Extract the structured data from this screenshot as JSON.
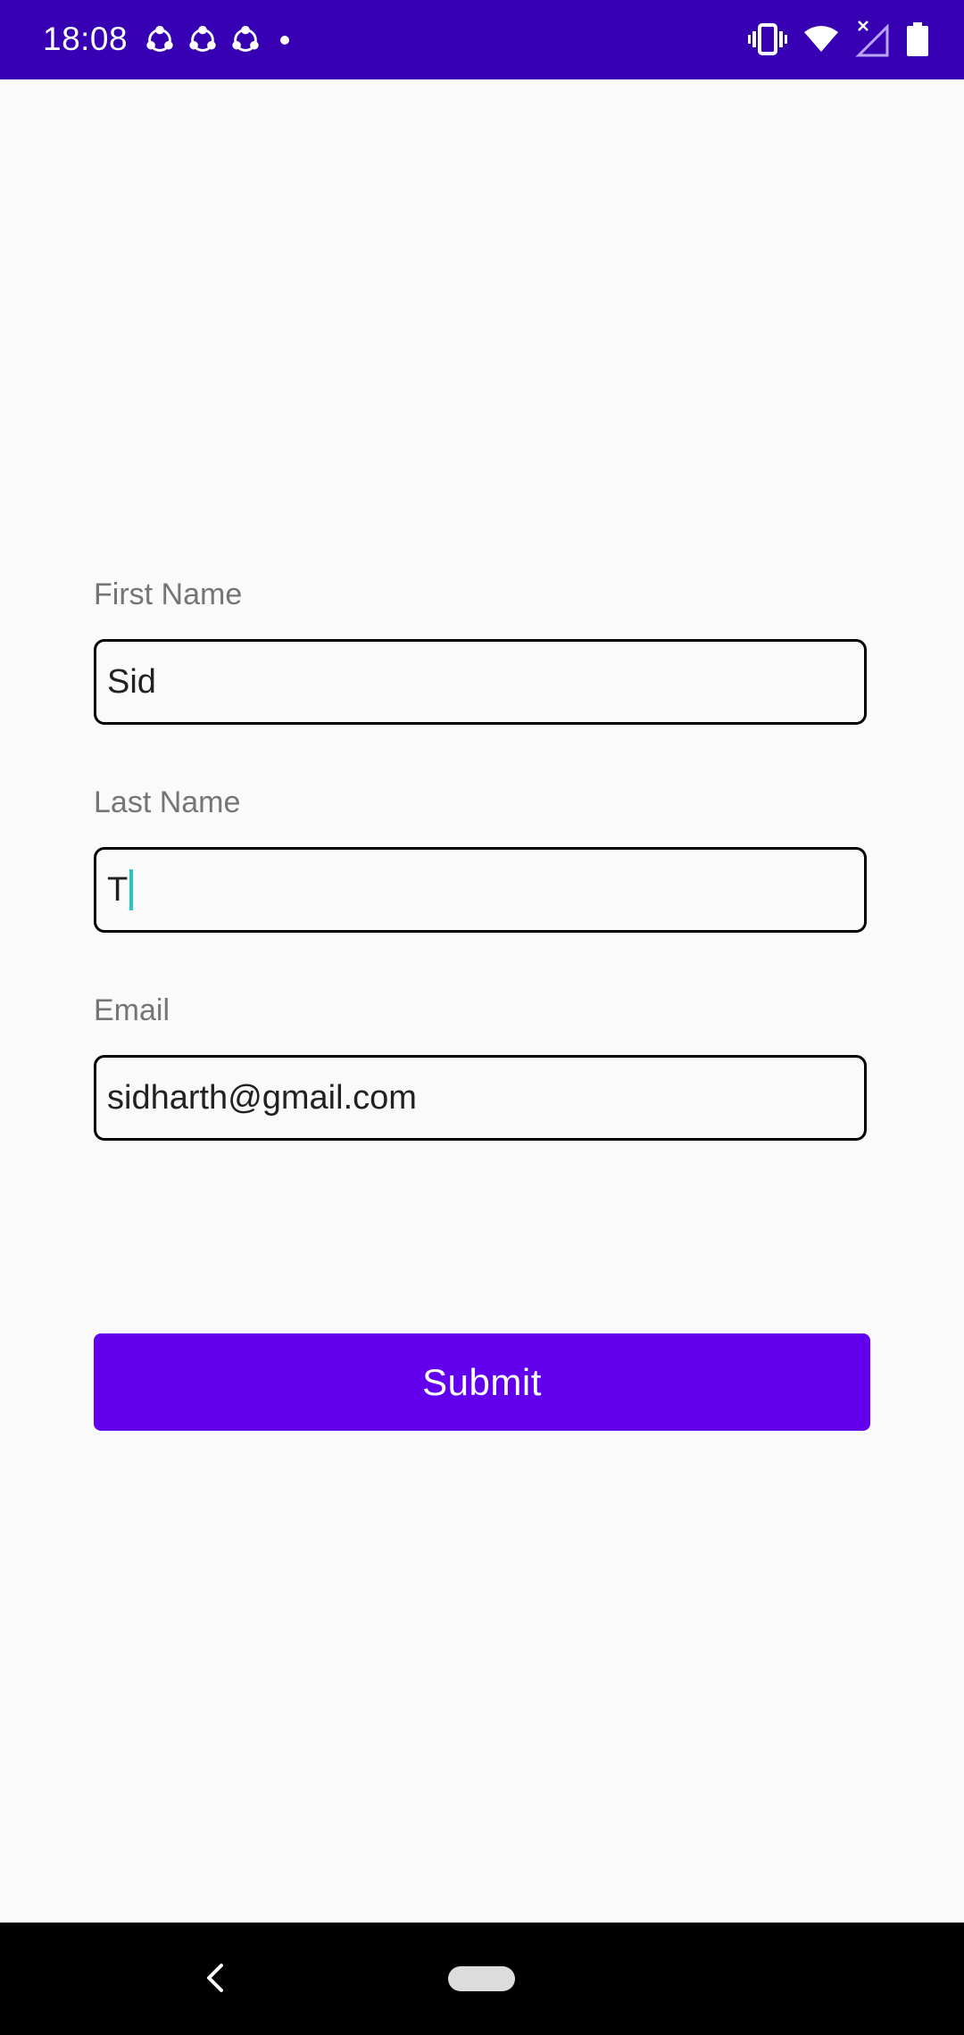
{
  "status_bar": {
    "time": "18:08",
    "notification_icons": [
      "share-icon",
      "share-icon",
      "share-icon",
      "dot-icon"
    ],
    "system_icons": [
      "vibrate-icon",
      "wifi-icon",
      "signal-no-data-icon",
      "battery-icon"
    ],
    "background": "#3700b3"
  },
  "form": {
    "first_name": {
      "label": "First Name",
      "value": "Sid"
    },
    "last_name": {
      "label": "Last Name",
      "value": "T"
    },
    "email": {
      "label": "Email",
      "value": "sidharth@gmail.com"
    },
    "submit_label": "Submit",
    "accent": "#6200ee",
    "cursor_color": "#26c6c6"
  },
  "nav_bar": {
    "icons": [
      "back-icon",
      "home-pill-icon"
    ]
  }
}
